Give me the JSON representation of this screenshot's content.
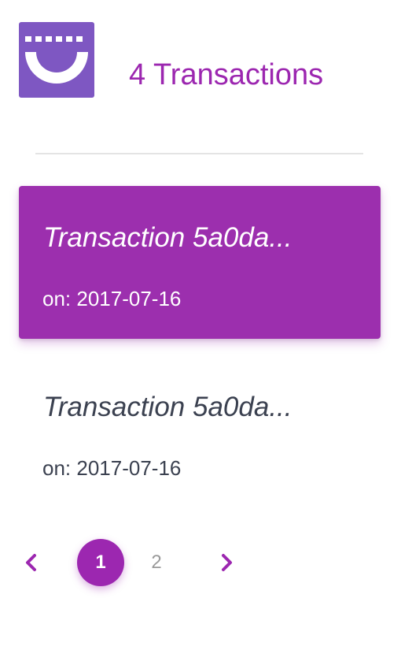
{
  "header": {
    "title": "4 Transactions",
    "logo_icon": "smile-logo-icon",
    "logo_color": "#7e57c2"
  },
  "transactions": [
    {
      "title": "Transaction 5a0da...",
      "date": "on: 2017-07-16",
      "selected": true
    },
    {
      "title": "Transaction 5a0da...",
      "date": "on: 2017-07-16",
      "selected": false
    }
  ],
  "pagination": {
    "prev_icon": "chevron-left-icon",
    "next_icon": "chevron-right-icon",
    "pages": [
      "1",
      "2"
    ],
    "current": "1"
  },
  "colors": {
    "accent": "#9c27b0",
    "text_dark": "#3b4150",
    "muted": "#9a9a9a"
  }
}
